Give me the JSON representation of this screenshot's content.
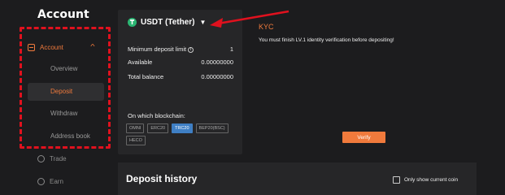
{
  "page": {
    "title": "Account"
  },
  "sidebar": {
    "parent": {
      "label": "Account"
    },
    "sub_items": [
      {
        "label": "Overview"
      },
      {
        "label": "Deposit",
        "active": true
      },
      {
        "label": "Withdraw"
      },
      {
        "label": "Address book"
      }
    ],
    "lower_items": [
      {
        "label": "Trade"
      },
      {
        "label": "Earn"
      }
    ]
  },
  "deposit_panel": {
    "coin": "USDT (Tether)",
    "rows": [
      {
        "label": "Minimum deposit limit",
        "value": "1"
      },
      {
        "label": "Available",
        "value": "0.00000000"
      },
      {
        "label": "Total balance",
        "value": "0.00000000"
      }
    ],
    "chain_label": "On which blockchain:",
    "chains": [
      {
        "label": "OMNI",
        "active": false
      },
      {
        "label": "ERC20",
        "active": false
      },
      {
        "label": "TRC20",
        "active": true
      },
      {
        "label": "BEP20(BSC)",
        "active": false
      },
      {
        "label": "HECO",
        "active": false
      }
    ]
  },
  "kyc": {
    "title": "KYC",
    "message": "You must finish LV.1 identity verification before depositing!",
    "button": "Verify"
  },
  "history": {
    "title": "Deposit history",
    "only_current_label": "Only show current coin"
  },
  "colors": {
    "accent": "#f07a3c",
    "annotation": "#e0111e",
    "chain_active": "#3f7fc4"
  }
}
